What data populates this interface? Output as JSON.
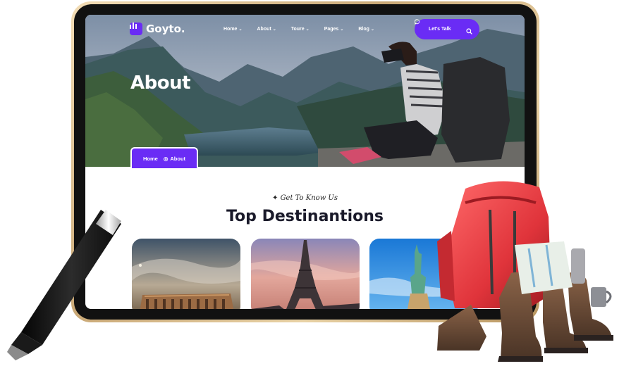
{
  "brand": {
    "name": "Goyto."
  },
  "nav": [
    {
      "label": "Home"
    },
    {
      "label": "About"
    },
    {
      "label": "Toure"
    },
    {
      "label": "Pages"
    },
    {
      "label": "Blog"
    }
  ],
  "cta": {
    "label": "Let's Talk"
  },
  "hero": {
    "title": "About"
  },
  "breadcrumb": {
    "home": "Home",
    "current": "About"
  },
  "section": {
    "eyebrow": "Get To Know Us",
    "title": "Top Destinantions"
  },
  "colors": {
    "accent": "#6a2cf5"
  },
  "icons": [
    "logo-icon",
    "chat-icon",
    "search-icon",
    "sparkle-icon",
    "chevron-down-icon"
  ]
}
